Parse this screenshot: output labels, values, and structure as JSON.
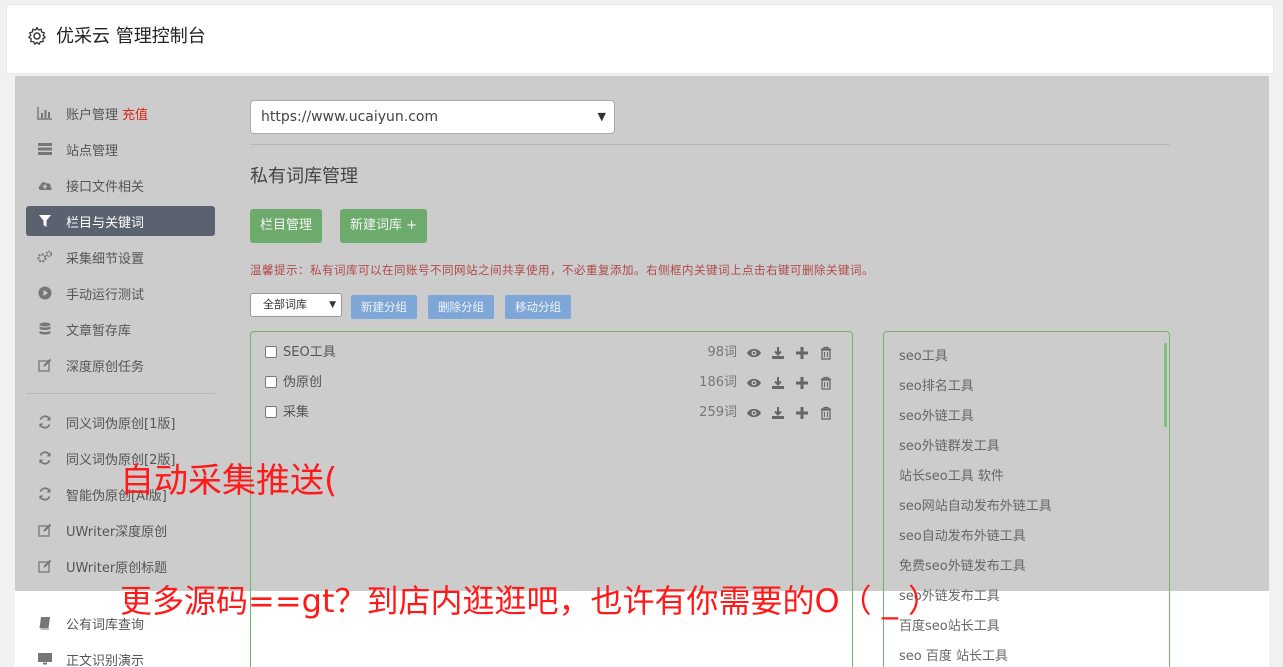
{
  "header": {
    "title": "优采云 管理控制台",
    "icon": "gear-icon"
  },
  "sidebar": {
    "items": [
      {
        "label": "账户管理",
        "tag": "充值",
        "icon": "bar-chart-icon"
      },
      {
        "label": "站点管理",
        "icon": "server-icon"
      },
      {
        "label": "接口文件相关",
        "icon": "cloud-upload-icon"
      },
      {
        "label": "栏目与关键词",
        "icon": "filter-icon",
        "active": true
      },
      {
        "label": "采集细节设置",
        "icon": "cogs-icon"
      },
      {
        "label": "手动运行测试",
        "icon": "play-circle-icon"
      },
      {
        "label": "文章暂存库",
        "icon": "database-icon"
      },
      {
        "label": "深度原创任务",
        "icon": "edit-icon"
      }
    ],
    "items2": [
      {
        "label": "同义词伪原创[1版]",
        "icon": "refresh-icon"
      },
      {
        "label": "同义词伪原创[2版]",
        "icon": "refresh-icon"
      },
      {
        "label": "智能伪原创[AI版]",
        "icon": "refresh-icon"
      },
      {
        "label": "UWriter深度原创",
        "icon": "edit-icon"
      },
      {
        "label": "UWriter原创标题",
        "icon": "edit-icon"
      }
    ],
    "items3": [
      {
        "label": "公有词库查询",
        "icon": "book-icon"
      },
      {
        "label": "正文识别演示",
        "icon": "monitor-icon"
      }
    ]
  },
  "site_select": {
    "value": "https://www.ucaiyun.com"
  },
  "page_title": "私有词库管理",
  "buttons": {
    "column_manage": "栏目管理",
    "new_library": "新建词库 +"
  },
  "tip": "温馨提示：私有词库可以在同账号不同网站之间共享使用，不必重复添加。右侧框内关键词上点击右键可删除关键词。",
  "group_select": {
    "value": "全部词库"
  },
  "group_buttons": {
    "new_group": "新建分组",
    "delete_group": "删除分组",
    "move_group": "移动分组"
  },
  "libraries": [
    {
      "name": "SEO工具",
      "count": "98词"
    },
    {
      "name": "伪原创",
      "count": "186词"
    },
    {
      "name": "采集",
      "count": "259词"
    }
  ],
  "keywords": [
    "seo工具",
    "seo排名工具",
    "seo外链工具",
    "seo外链群发工具",
    "站长seo工具 软件",
    "seo网站自动发布外链工具",
    "seo自动发布外链工具",
    "免费seo外链发布工具",
    "seo外链发布工具",
    "百度seo站长工具",
    "seo 百度 站长工具"
  ],
  "overlay": {
    "line1": "自动采集推送(",
    "line2": "更多源码==gt？到店内逛逛吧，也许有你需要的O（ _ ）"
  },
  "colors": {
    "active_item": "#5a6270",
    "green_button": "#6cab6c",
    "blue_button": "#7ea6d6",
    "overlay_text": "#ff1a1a",
    "tip_text": "#b0484a"
  }
}
